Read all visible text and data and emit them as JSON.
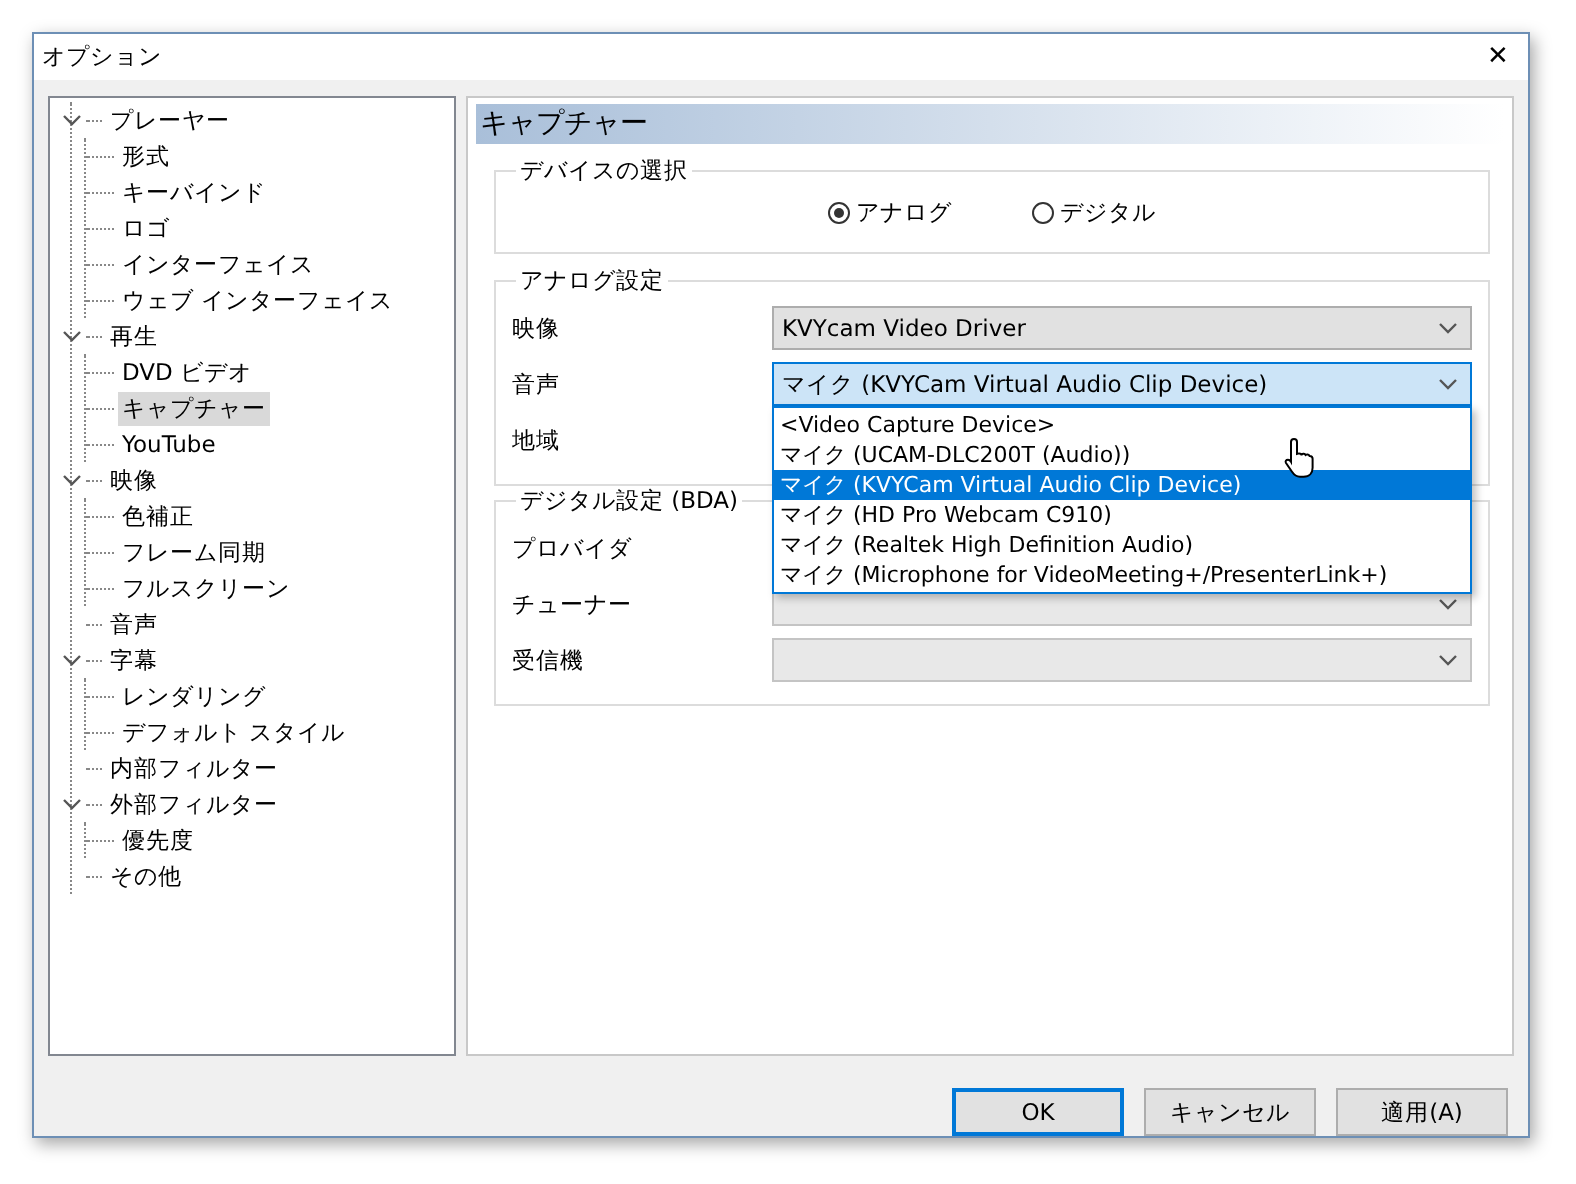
{
  "window": {
    "title": "オプション",
    "close": "✕"
  },
  "tree": [
    {
      "label": "プレーヤー",
      "expanded": true,
      "selected": false,
      "children": [
        {
          "label": "形式",
          "selected": false
        },
        {
          "label": "キーバインド",
          "selected": false
        },
        {
          "label": "ロゴ",
          "selected": false
        },
        {
          "label": "インターフェイス",
          "selected": false
        },
        {
          "label": "ウェブ インターフェイス",
          "selected": false
        }
      ]
    },
    {
      "label": "再生",
      "expanded": true,
      "selected": false,
      "children": [
        {
          "label": "DVD ビデオ",
          "selected": false
        },
        {
          "label": "キャプチャー",
          "selected": true
        },
        {
          "label": "YouTube",
          "selected": false
        }
      ]
    },
    {
      "label": "映像",
      "expanded": true,
      "selected": false,
      "children": [
        {
          "label": "色補正",
          "selected": false
        },
        {
          "label": "フレーム同期",
          "selected": false
        },
        {
          "label": "フルスクリーン",
          "selected": false
        }
      ]
    },
    {
      "label": "音声",
      "selected": false
    },
    {
      "label": "字幕",
      "expanded": true,
      "selected": false,
      "children": [
        {
          "label": "レンダリング",
          "selected": false
        },
        {
          "label": "デフォルト スタイル",
          "selected": false
        }
      ]
    },
    {
      "label": "内部フィルター",
      "selected": false
    },
    {
      "label": "外部フィルター",
      "expanded": true,
      "selected": false,
      "children": [
        {
          "label": "優先度",
          "selected": false
        }
      ]
    },
    {
      "label": "その他",
      "selected": false
    }
  ],
  "panel": {
    "title": "キャプチャー",
    "device_group": {
      "title": "デバイスの選択",
      "radios": [
        {
          "label": "アナログ",
          "selected": true
        },
        {
          "label": "デジタル",
          "selected": false
        }
      ]
    },
    "analog_group": {
      "title": "アナログ設定",
      "rows": [
        {
          "label": "映像",
          "kind": "combo",
          "value": "KVYcam Video Driver",
          "focused": false
        },
        {
          "label": "音声",
          "kind": "combo",
          "value": "マイク (KVYCam Virtual Audio Clip Device)",
          "focused": true,
          "dropdown": [
            {
              "label": "<Video Capture Device>",
              "selected": false
            },
            {
              "label": "マイク (UCAM-DLC200T (Audio))",
              "selected": false
            },
            {
              "label": "マイク (KVYCam Virtual Audio Clip Device)",
              "selected": true
            },
            {
              "label": "マイク (HD Pro Webcam C910)",
              "selected": false
            },
            {
              "label": "マイク (Realtek High Definition Audio)",
              "selected": false
            },
            {
              "label": "マイク (Microphone for VideoMeeting+/PresenterLink+)",
              "selected": false
            }
          ]
        },
        {
          "label": "地域",
          "kind": "label"
        }
      ]
    },
    "digital_group": {
      "title": "デジタル設定 (BDA)",
      "rows": [
        {
          "label": "プロバイダ",
          "kind": "label"
        },
        {
          "label": "チューナー",
          "kind": "combo",
          "disabled": true
        },
        {
          "label": "受信機",
          "kind": "combo",
          "disabled": true
        }
      ]
    }
  },
  "buttons": [
    {
      "label": "OK",
      "default": true
    },
    {
      "label": "キャンセル",
      "default": false
    },
    {
      "label": "適用(A)",
      "default": false
    }
  ]
}
